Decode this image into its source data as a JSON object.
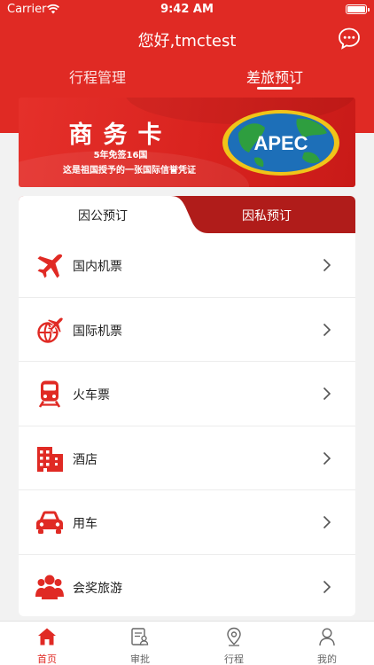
{
  "status_bar": {
    "carrier": "Carrier",
    "time": "9:42 AM"
  },
  "header": {
    "greeting": "您好,tmctest"
  },
  "top_tabs": [
    {
      "label": "行程管理",
      "active": false
    },
    {
      "label": "差旅预订",
      "active": true
    }
  ],
  "banner": {
    "title": "商务卡",
    "subtitle": "5年免签16国",
    "tagline": "这是祖国授予的一张国际信誉凭证",
    "logo_text": "APEC"
  },
  "booking_tabs": [
    {
      "label": "因公预订",
      "active": true
    },
    {
      "label": "因私预订",
      "active": false
    }
  ],
  "menu": [
    {
      "label": "国内机票",
      "icon": "plane-icon"
    },
    {
      "label": "国际机票",
      "icon": "globe-plane-icon"
    },
    {
      "label": "火车票",
      "icon": "train-icon"
    },
    {
      "label": "酒店",
      "icon": "hotel-icon"
    },
    {
      "label": "用车",
      "icon": "car-icon"
    },
    {
      "label": "会奖旅游",
      "icon": "group-icon"
    }
  ],
  "tabbar": [
    {
      "label": "首页",
      "icon": "home-icon",
      "active": true
    },
    {
      "label": "审批",
      "icon": "approval-icon",
      "active": false
    },
    {
      "label": "行程",
      "icon": "location-icon",
      "active": false
    },
    {
      "label": "我的",
      "icon": "profile-icon",
      "active": false
    }
  ],
  "colors": {
    "accent": "#e02a24",
    "dark_red": "#b01c1a",
    "text": "#222222",
    "inactive": "#666666"
  }
}
